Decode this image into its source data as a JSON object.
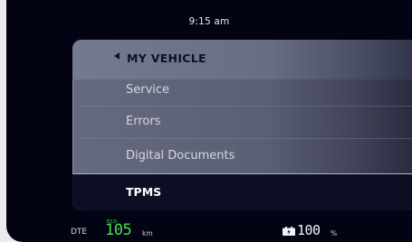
{
  "status_bar": {
    "time": "9:15 am"
  },
  "menu": {
    "title": "MY VEHICLE",
    "back_icon": "caret-left-icon",
    "items": [
      {
        "label": "Service"
      },
      {
        "label": "Errors"
      },
      {
        "label": "Digital Documents"
      },
      {
        "label": "TPMS",
        "selected": true
      }
    ]
  },
  "bottom_bar": {
    "dte_label": "DTE",
    "mode": "ECO",
    "range_value": "105",
    "range_unit": "km",
    "battery_icon": "battery-charging-icon",
    "battery_value": "100",
    "battery_unit": "%"
  },
  "colors": {
    "background": "#020414",
    "panel": "#666a7f",
    "selected_row": "#0c0f24",
    "range_green": "#46e04c"
  }
}
